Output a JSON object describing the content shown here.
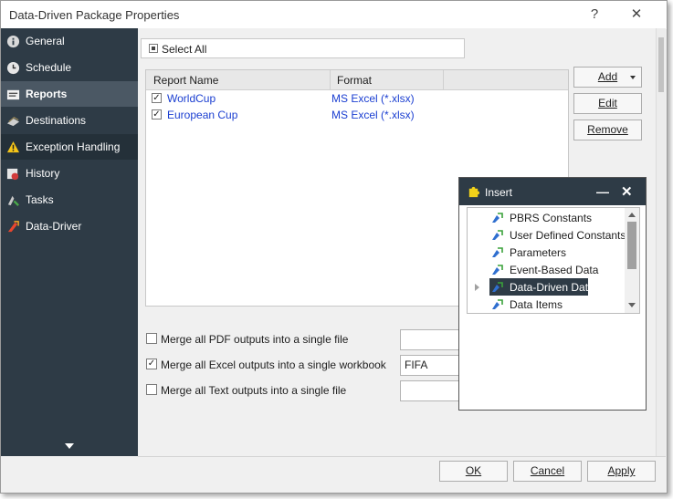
{
  "window": {
    "title": "Data-Driven Package Properties",
    "help_glyph": "?",
    "close_glyph": "✕"
  },
  "sidebar": {
    "items": [
      {
        "label": "General",
        "icon": "info-icon",
        "active": false
      },
      {
        "label": "Schedule",
        "icon": "clock-icon",
        "active": false
      },
      {
        "label": "Reports",
        "icon": "reports-icon",
        "active": true
      },
      {
        "label": "Destinations",
        "icon": "destinations-icon",
        "active": false
      },
      {
        "label": "Exception Handling",
        "icon": "warning-icon",
        "active": false
      },
      {
        "label": "History",
        "icon": "history-icon",
        "active": false
      },
      {
        "label": "Tasks",
        "icon": "tasks-icon",
        "active": false
      },
      {
        "label": "Data-Driver",
        "icon": "data-driver-icon",
        "active": false
      }
    ]
  },
  "reports": {
    "select_all_label": "Select All",
    "columns": [
      "Report Name",
      "Format"
    ],
    "rows": [
      {
        "checked": true,
        "name": "WorldCup",
        "format": "MS Excel (*.xlsx)"
      },
      {
        "checked": true,
        "name": "European Cup",
        "format": "MS Excel (*.xlsx)"
      }
    ],
    "buttons": {
      "add": "Add",
      "edit": "Edit",
      "remove": "Remove"
    }
  },
  "merge": {
    "pdf_label": "Merge all PDF outputs into a single file",
    "pdf_checked": false,
    "pdf_value": "",
    "excel_label": "Merge all Excel outputs into a single workbook",
    "excel_checked": true,
    "excel_value": "FIFA",
    "text_label": "Merge all Text outputs into a single file",
    "text_checked": false,
    "text_value": ""
  },
  "insert_popup": {
    "title": "Insert",
    "minimize_glyph": "—",
    "close_glyph": "✕",
    "items": [
      {
        "label": "PBRS Constants",
        "selected": false
      },
      {
        "label": "User Defined Constants",
        "selected": false
      },
      {
        "label": "Parameters",
        "selected": false
      },
      {
        "label": "Event-Based Data",
        "selected": false
      },
      {
        "label": "Data-Driven Data",
        "selected": true
      },
      {
        "label": "Data Items",
        "selected": false
      }
    ]
  },
  "footer": {
    "ok": "OK",
    "cancel": "Cancel",
    "apply": "Apply"
  },
  "colors": {
    "sidebar_bg": "#2e3b46",
    "link_blue": "#1a3ed1",
    "popup_title_bg": "#2e3b46"
  }
}
